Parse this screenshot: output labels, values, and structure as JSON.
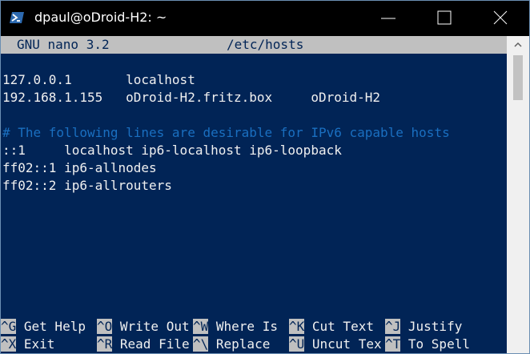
{
  "window": {
    "title": "dpaul@oDroid-H2: ~",
    "icons": {
      "app": "powershell-icon",
      "minimize": "minimize-icon",
      "maximize": "maximize-icon",
      "close": "close-icon"
    }
  },
  "nano": {
    "version": "GNU nano 3.2",
    "filename": "/etc/hosts",
    "lines": [
      {
        "row": 2,
        "text": "127.0.0.1       localhost",
        "comment": false
      },
      {
        "row": 3,
        "text": "192.168.1.155   oDroid-H2.fritz.box     oDroid-H2",
        "comment": false
      },
      {
        "row": 5,
        "text": "# The following lines are desirable for IPv6 capable hosts",
        "comment": true
      },
      {
        "row": 6,
        "text": "::1     localhost ip6-localhost ip6-loopback",
        "comment": false
      },
      {
        "row": 7,
        "text": "ff02::1 ip6-allnodes",
        "comment": false
      },
      {
        "row": 8,
        "text": "ff02::2 ip6-allrouters",
        "comment": false
      }
    ],
    "shortcuts": [
      [
        {
          "key": "^G",
          "label": " Get Help "
        },
        {
          "key": "^O",
          "label": " Write Out"
        },
        {
          "key": "^W",
          "label": " Where Is "
        },
        {
          "key": "^K",
          "label": " Cut Text "
        },
        {
          "key": "^J",
          "label": " Justify"
        }
      ],
      [
        {
          "key": "^X",
          "label": " Exit     "
        },
        {
          "key": "^R",
          "label": " Read File"
        },
        {
          "key": "^\\",
          "label": " Replace  "
        },
        {
          "key": "^U",
          "label": " Uncut Tex"
        },
        {
          "key": "^T",
          "label": " To Spell"
        }
      ]
    ]
  },
  "colors": {
    "background": "#012456",
    "text": "#f0f0f0",
    "comment": "#1a6fc0",
    "inverse_bg": "#c0c0c0"
  }
}
